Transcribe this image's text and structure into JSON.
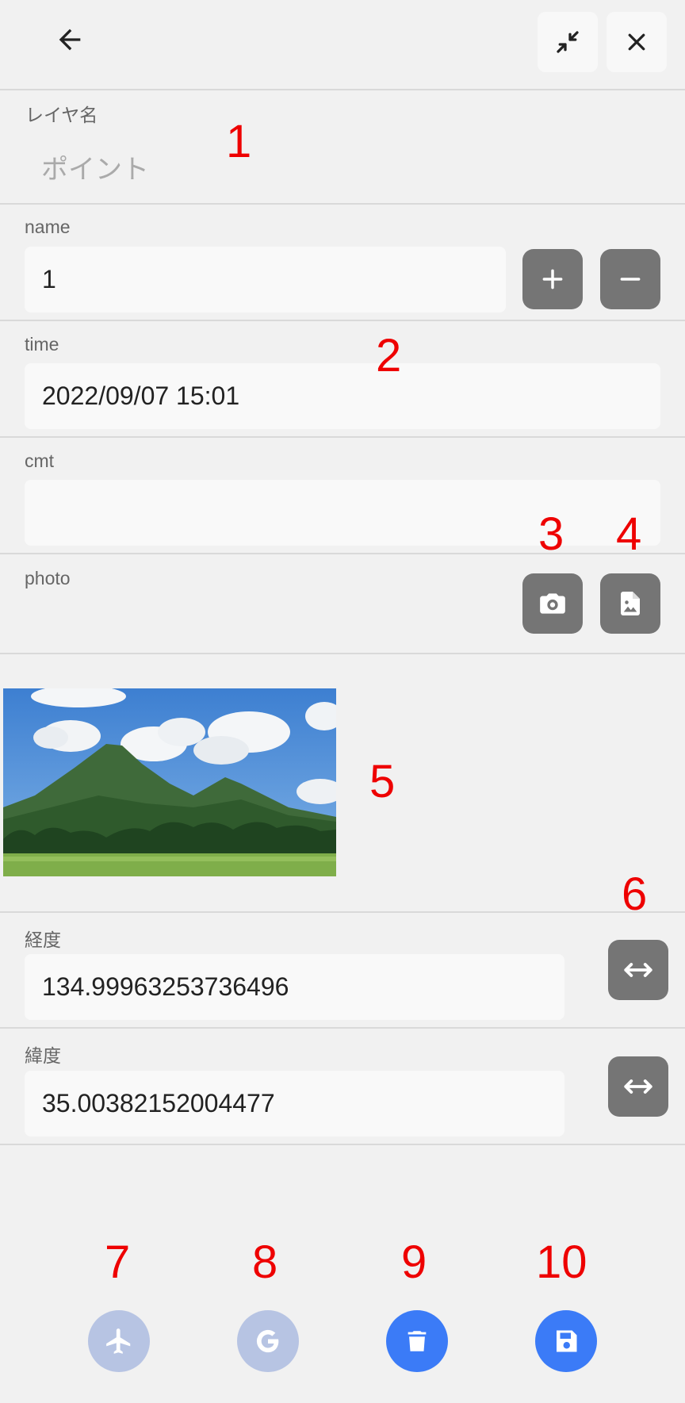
{
  "header": {
    "back_icon": "arrow-left-icon",
    "collapse_icon": "collapse-arrows-icon",
    "close_icon": "close-icon"
  },
  "layer": {
    "label": "レイヤ名",
    "value": "ポイント"
  },
  "fields": {
    "name": {
      "label": "name",
      "value": "1"
    },
    "time": {
      "label": "time",
      "value": "2022/09/07 15:01"
    },
    "cmt": {
      "label": "cmt",
      "value": ""
    },
    "photo": {
      "label": "photo"
    },
    "longitude": {
      "label": "経度",
      "value": "134.99963253736496"
    },
    "latitude": {
      "label": "緯度",
      "value": "35.00382152004477"
    }
  },
  "annotations": [
    "1",
    "2",
    "3",
    "4",
    "5",
    "6",
    "7",
    "8",
    "9",
    "10"
  ],
  "bottom_actions": [
    {
      "name": "airplane-icon",
      "color": "#b7c4e3"
    },
    {
      "name": "google-g-icon",
      "color": "#b7c4e3"
    },
    {
      "name": "trash-icon",
      "color": "#3b7bf7"
    },
    {
      "name": "save-icon",
      "color": "#3b7bf7"
    }
  ],
  "colors": {
    "grey_button": "#757575",
    "accent_blue": "#3b7bf7",
    "disabled_blue": "#b7c4e3",
    "annotation_red": "#ee0000"
  }
}
